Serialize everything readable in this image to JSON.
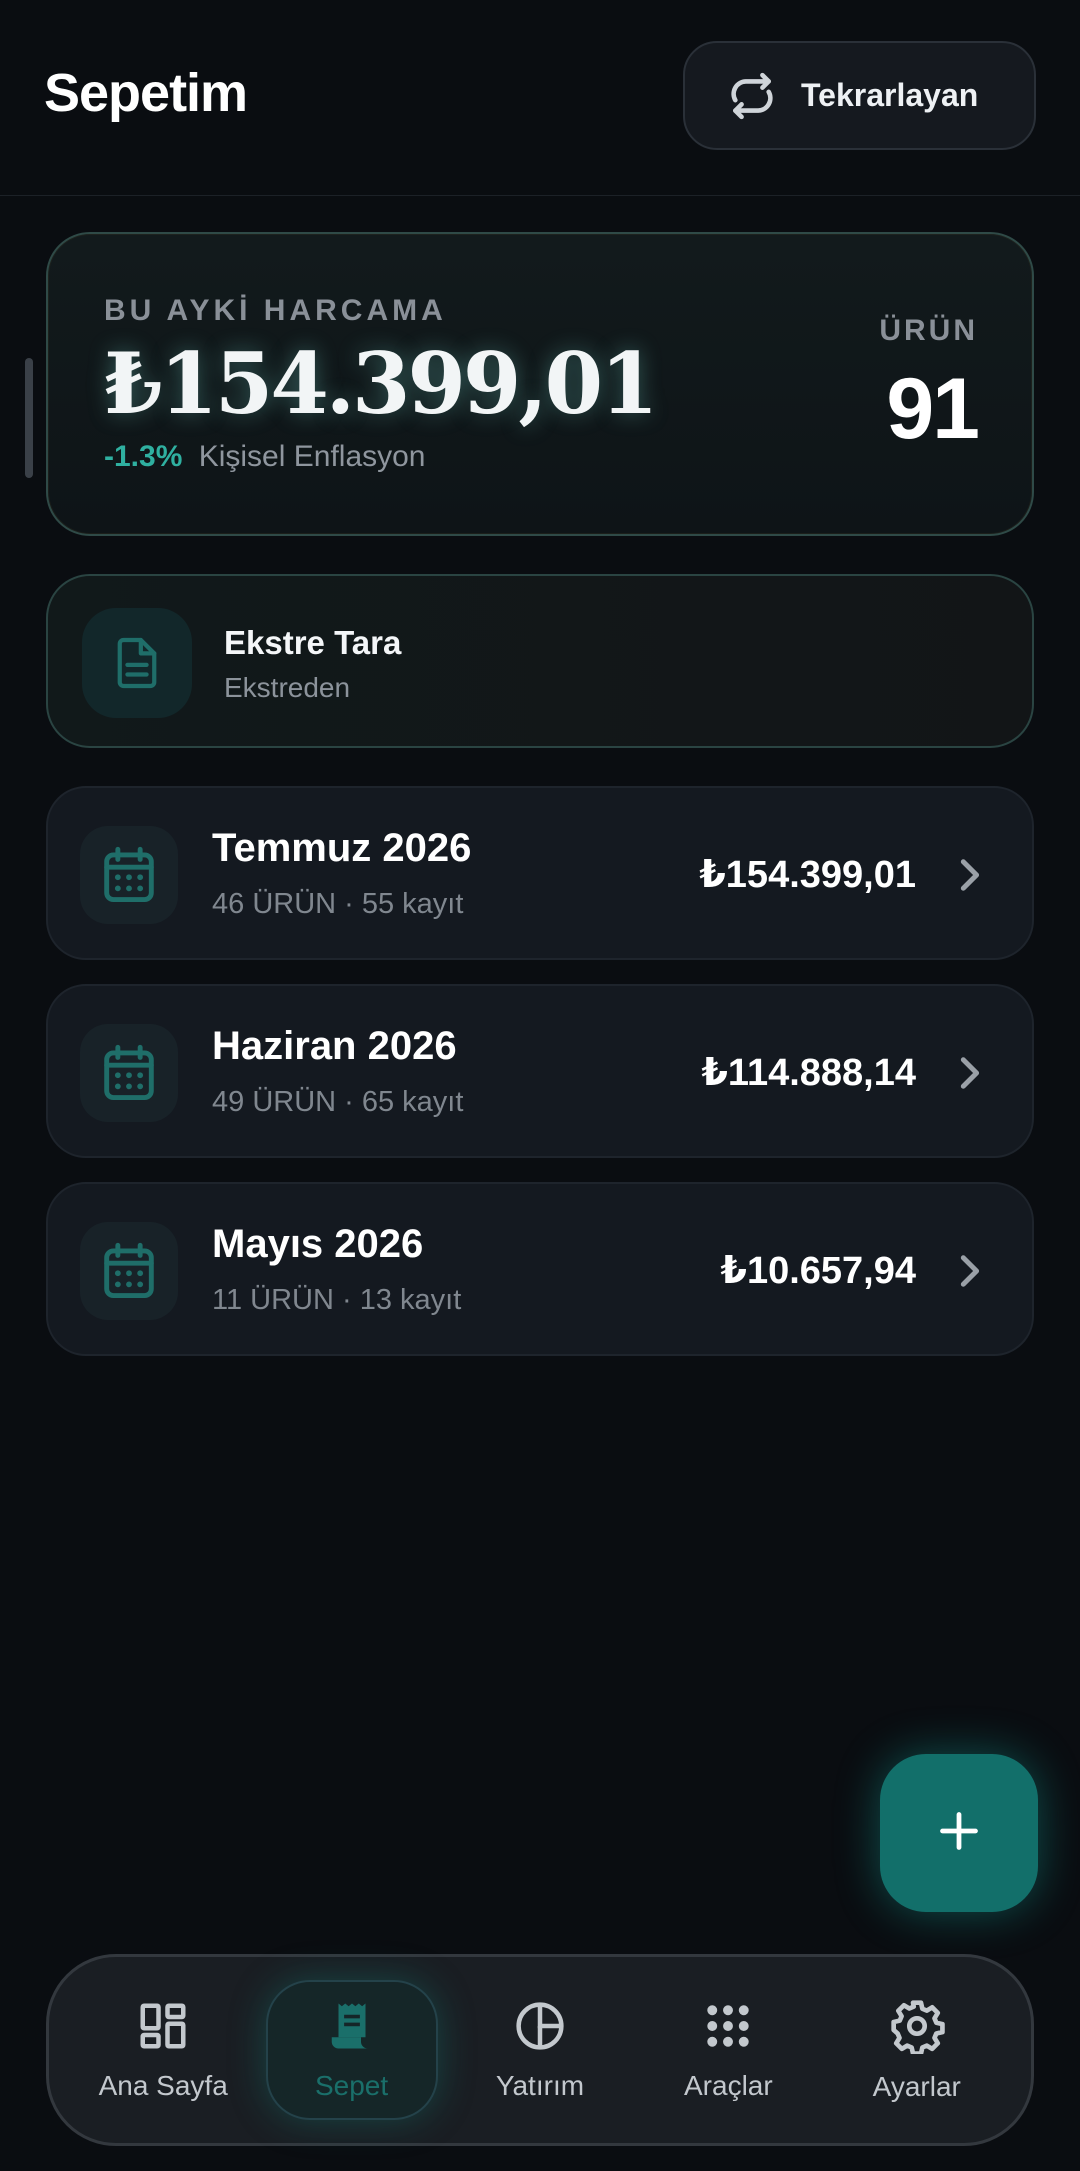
{
  "header": {
    "title": "Sepetim",
    "recurring_label": "Tekrarlayan"
  },
  "summary": {
    "label": "BU AYKİ HARCAMA",
    "amount": "₺154.399,01",
    "inflation_pct": "-1.3%",
    "inflation_label": "Kişisel Enflasyon",
    "item_label": "ÜRÜN",
    "item_count": "91"
  },
  "scan": {
    "title": "Ekstre Tara",
    "subtitle": "Ekstreden"
  },
  "months": [
    {
      "title": "Temmuz 2026",
      "subtitle": "46 ÜRÜN · 55 kayıt",
      "amount": "₺154.399,01"
    },
    {
      "title": "Haziran 2026",
      "subtitle": "49 ÜRÜN · 65 kayıt",
      "amount": "₺114.888,14"
    },
    {
      "title": "Mayıs 2026",
      "subtitle": "11 ÜRÜN · 13 kayıt",
      "amount": "₺10.657,94"
    }
  ],
  "nav": [
    {
      "label": "Ana Sayfa",
      "icon": "dashboard-icon"
    },
    {
      "label": "Sepet",
      "icon": "receipt-icon",
      "active": true
    },
    {
      "label": "Yatırım",
      "icon": "pie-chart-icon"
    },
    {
      "label": "Araçlar",
      "icon": "grid-dots-icon"
    },
    {
      "label": "Ayarlar",
      "icon": "gear-icon"
    }
  ],
  "colors": {
    "background": "#0a0d11",
    "accent": "#126f6a",
    "accent_text": "#2fb0a0",
    "card": "#141920"
  }
}
